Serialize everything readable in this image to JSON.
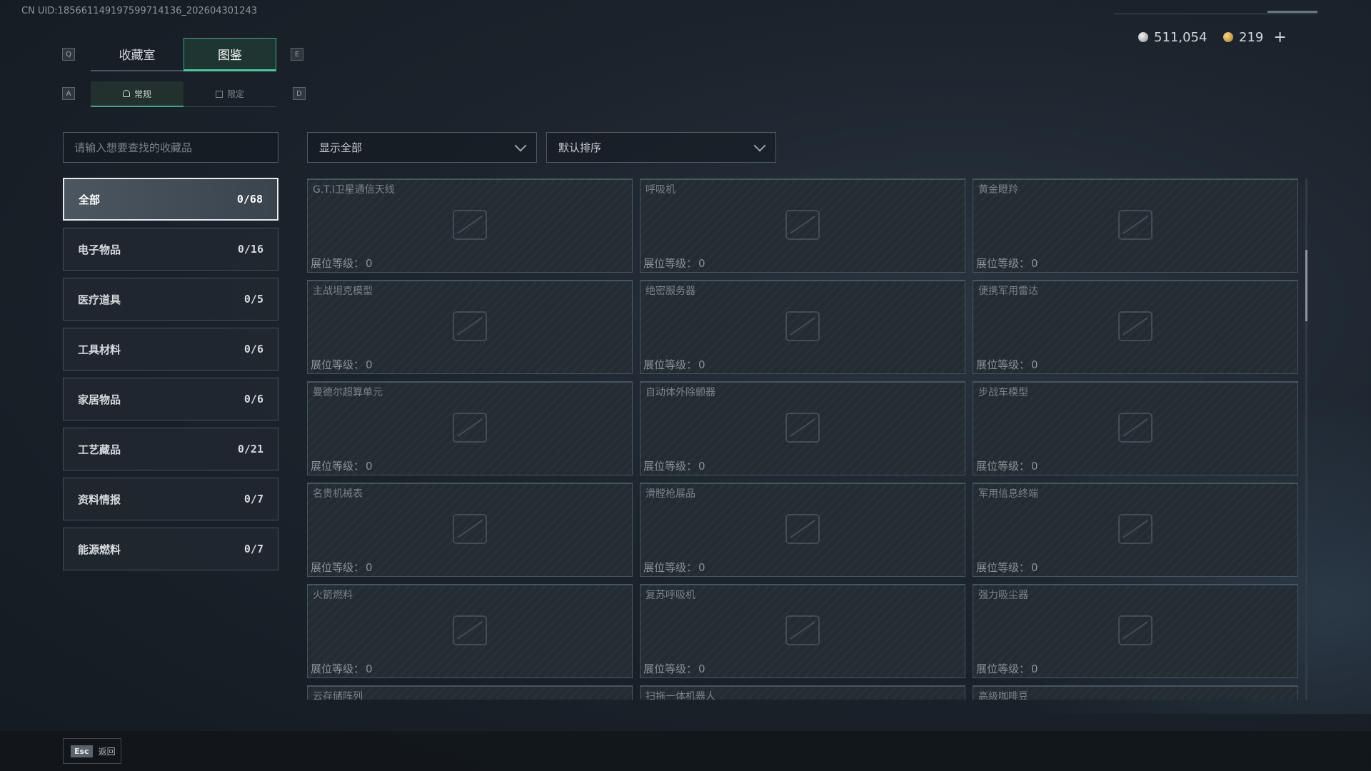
{
  "uid": "CN UID:185661149197599714136_202604301243",
  "currency": {
    "silver": "511,054",
    "gold": "219",
    "plus": "+"
  },
  "keys": {
    "q": "Q",
    "e": "E",
    "a": "A",
    "d": "D"
  },
  "main_tabs": [
    {
      "label": "收藏室"
    },
    {
      "label": "图鉴"
    }
  ],
  "sub_tabs": [
    {
      "label": "常规"
    },
    {
      "label": "限定"
    }
  ],
  "search": {
    "placeholder": "请输入想要查找的收藏品"
  },
  "filter": {
    "value": "显示全部"
  },
  "sort": {
    "value": "默认排序"
  },
  "categories": [
    {
      "label": "全部",
      "count": "0/68"
    },
    {
      "label": "电子物品",
      "count": "0/16"
    },
    {
      "label": "医疗道具",
      "count": "0/5"
    },
    {
      "label": "工具材料",
      "count": "0/6"
    },
    {
      "label": "家居物品",
      "count": "0/6"
    },
    {
      "label": "工艺藏品",
      "count": "0/21"
    },
    {
      "label": "资料情报",
      "count": "0/7"
    },
    {
      "label": "能源燃料",
      "count": "0/7"
    }
  ],
  "level_label": "展位等级：",
  "items": [
    {
      "name": "G.T.I卫星通信天线",
      "level": "0",
      "icon": "dish-icon"
    },
    {
      "name": "呼吸机",
      "level": "0",
      "icon": "ventilator-icon"
    },
    {
      "name": "黄金瞪羚",
      "level": "0",
      "icon": "gazelle-icon"
    },
    {
      "name": "主战坦克模型",
      "level": "0",
      "icon": "tank-icon"
    },
    {
      "name": "绝密服务器",
      "level": "0",
      "icon": "server-icon"
    },
    {
      "name": "便携军用雷达",
      "level": "0",
      "icon": "radar-icon"
    },
    {
      "name": "曼德尔超算单元",
      "level": "0",
      "icon": "chip-icon"
    },
    {
      "name": "自动体外除颤器",
      "level": "0",
      "icon": "defibrillator-icon"
    },
    {
      "name": "步战车模型",
      "level": "0",
      "icon": "ifv-icon"
    },
    {
      "name": "名贵机械表",
      "level": "0",
      "icon": "watch-icon"
    },
    {
      "name": "滑膛枪展品",
      "level": "0",
      "icon": "musket-icon"
    },
    {
      "name": "军用信息终端",
      "level": "0",
      "icon": "terminal-icon"
    },
    {
      "name": "火箭燃料",
      "level": "0",
      "icon": "fuel-icon"
    },
    {
      "name": "复苏呼吸机",
      "level": "0",
      "icon": "resuscitator-icon"
    },
    {
      "name": "强力吸尘器",
      "level": "0",
      "icon": "vacuum-icon"
    },
    {
      "name": "云存储阵列",
      "level": "",
      "icon": "storage-icon"
    },
    {
      "name": "扫拖一体机器人",
      "level": "",
      "icon": "robot-icon"
    },
    {
      "name": "高级咖啡豆",
      "level": "",
      "icon": "coffee-icon"
    }
  ],
  "footer": {
    "esc_key": "Esc",
    "back_label": "返回"
  }
}
